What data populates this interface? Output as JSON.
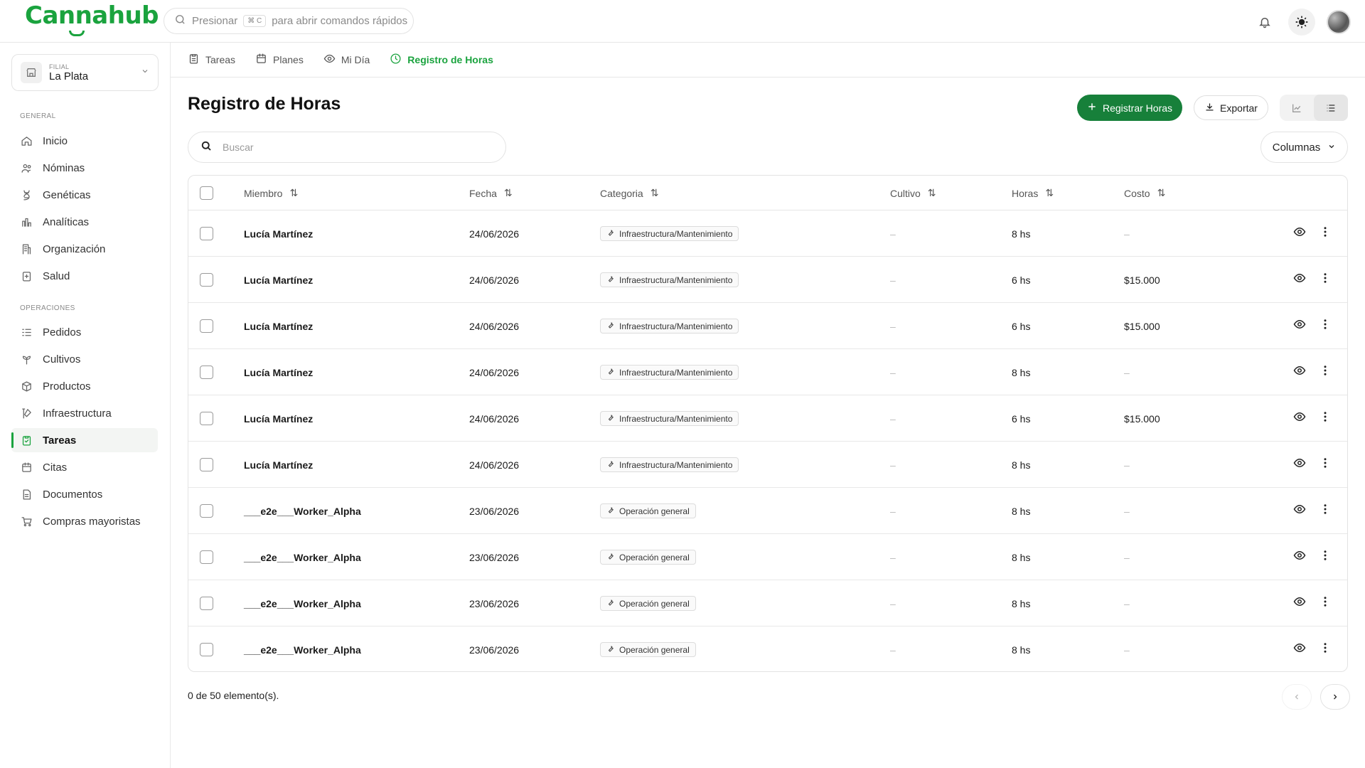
{
  "brand": {
    "name": "Cannahub",
    "color": "#1aa33e"
  },
  "command_bar": {
    "prefix": "Presionar",
    "shortcut": "⌘ C",
    "suffix": "para abrir comandos rápidos"
  },
  "filial": {
    "label": "FILIAL",
    "value": "La Plata"
  },
  "sidebar": {
    "general_label": "GENERAL",
    "general_items": [
      {
        "label": "Inicio",
        "icon": "home-icon"
      },
      {
        "label": "Nóminas",
        "icon": "people-icon"
      },
      {
        "label": "Genéticas",
        "icon": "dna-icon"
      },
      {
        "label": "Analíticas",
        "icon": "bar-chart-icon"
      },
      {
        "label": "Organización",
        "icon": "building-icon"
      },
      {
        "label": "Salud",
        "icon": "health-clipboard-icon"
      }
    ],
    "ops_label": "OPERACIONES",
    "ops_items": [
      {
        "label": "Pedidos",
        "icon": "list-ordered-icon"
      },
      {
        "label": "Cultivos",
        "icon": "sprout-icon"
      },
      {
        "label": "Productos",
        "icon": "package-icon"
      },
      {
        "label": "Infraestructura",
        "icon": "tools-icon"
      },
      {
        "label": "Tareas",
        "icon": "clipboard-check-icon",
        "active": true
      },
      {
        "label": "Citas",
        "icon": "calendar-icon"
      },
      {
        "label": "Documentos",
        "icon": "document-icon"
      },
      {
        "label": "Compras mayoristas",
        "icon": "cart-icon"
      }
    ]
  },
  "tabs": [
    {
      "label": "Tareas",
      "icon": "clipboard-icon"
    },
    {
      "label": "Planes",
      "icon": "calendar-icon"
    },
    {
      "label": "Mi Día",
      "icon": "eye-icon"
    },
    {
      "label": "Registro de Horas",
      "icon": "clock-icon",
      "active": true
    }
  ],
  "page": {
    "title": "Registro de Horas",
    "primary_button": "Registrar Horas",
    "export_button": "Exportar",
    "search_placeholder": "Buscar",
    "columns_button": "Columnas"
  },
  "table": {
    "headers": [
      "Miembro",
      "Fecha",
      "Categoria",
      "Cultivo",
      "Horas",
      "Costo"
    ],
    "rows": [
      {
        "member": "Lucía Martínez",
        "date": "24/06/2026",
        "category": "Infraestructura/Mantenimiento",
        "crop": "–",
        "hours": "8 hs",
        "cost": "–"
      },
      {
        "member": "Lucía Martínez",
        "date": "24/06/2026",
        "category": "Infraestructura/Mantenimiento",
        "crop": "–",
        "hours": "6 hs",
        "cost": "$15.000"
      },
      {
        "member": "Lucía Martínez",
        "date": "24/06/2026",
        "category": "Infraestructura/Mantenimiento",
        "crop": "–",
        "hours": "6 hs",
        "cost": "$15.000"
      },
      {
        "member": "Lucía Martínez",
        "date": "24/06/2026",
        "category": "Infraestructura/Mantenimiento",
        "crop": "–",
        "hours": "8 hs",
        "cost": "–"
      },
      {
        "member": "Lucía Martínez",
        "date": "24/06/2026",
        "category": "Infraestructura/Mantenimiento",
        "crop": "–",
        "hours": "6 hs",
        "cost": "$15.000"
      },
      {
        "member": "Lucía Martínez",
        "date": "24/06/2026",
        "category": "Infraestructura/Mantenimiento",
        "crop": "–",
        "hours": "8 hs",
        "cost": "–"
      },
      {
        "member": "___e2e___Worker_Alpha",
        "date": "23/06/2026",
        "category": "Operación general",
        "crop": "–",
        "hours": "8 hs",
        "cost": "–"
      },
      {
        "member": "___e2e___Worker_Alpha",
        "date": "23/06/2026",
        "category": "Operación general",
        "crop": "–",
        "hours": "8 hs",
        "cost": "–"
      },
      {
        "member": "___e2e___Worker_Alpha",
        "date": "23/06/2026",
        "category": "Operación general",
        "crop": "–",
        "hours": "8 hs",
        "cost": "–"
      },
      {
        "member": "___e2e___Worker_Alpha",
        "date": "23/06/2026",
        "category": "Operación general",
        "crop": "–",
        "hours": "8 hs",
        "cost": "–"
      }
    ]
  },
  "footer": {
    "count_text": "0 de 50 elemento(s)."
  }
}
